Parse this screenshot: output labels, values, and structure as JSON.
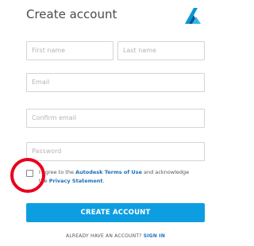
{
  "header": {
    "title": "Create account",
    "logo_icon": "autodesk-logo-icon",
    "logo_color": "#0696d7"
  },
  "form": {
    "first_name_placeholder": "First name",
    "last_name_placeholder": "Last name",
    "email_placeholder": "Email",
    "confirm_email_placeholder": "Confirm email",
    "password_placeholder": "Password"
  },
  "terms": {
    "checked": false,
    "text_before": "I agree to the ",
    "terms_link": "Autodesk Terms of Use",
    "text_middle": " and acknowledge the ",
    "privacy_link": "Privacy Statement",
    "text_after": "."
  },
  "actions": {
    "create_account_label": "CREATE ACCOUNT",
    "have_account_text": "ALREADY HAVE AN ACCOUNT? ",
    "sign_in_link": "SIGN IN"
  },
  "annotation": {
    "highlight_icon": "red-circle-highlight",
    "color": "#e8001c"
  },
  "colors": {
    "accent": "#0d9ee2",
    "link": "#1d6fb8"
  }
}
